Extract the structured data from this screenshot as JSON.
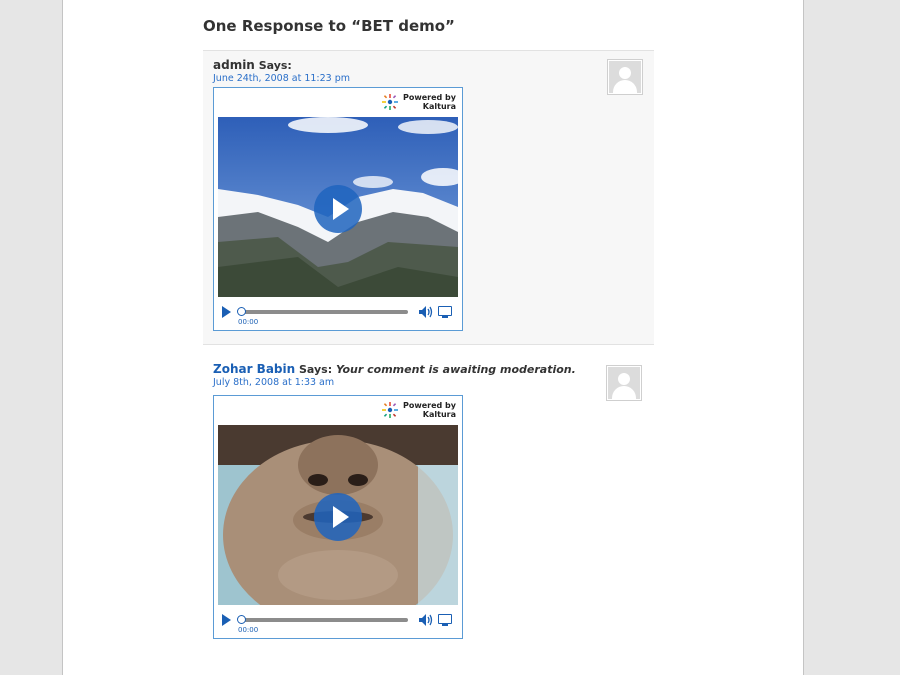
{
  "heading": "One Response to “BET demo”",
  "comments": [
    {
      "author": "admin",
      "says": "Says:",
      "moderation": "",
      "date": "June 24th, 2008 at 11:23 pm",
      "player": {
        "powered_line1": "Powered by",
        "powered_line2": "Kaltura",
        "time": "00:00",
        "progress": 0
      }
    },
    {
      "author": "Zohar Babin",
      "says": "Says:",
      "moderation": "Your comment is awaiting moderation.",
      "date": "July 8th, 2008 at 1:33 am",
      "player": {
        "powered_line1": "Powered by",
        "powered_line2": "Kaltura",
        "time": "00:00",
        "progress": 0
      }
    }
  ],
  "colors": {
    "link": "#1a5fb4",
    "accent": "#5b9bd5",
    "comment_bg": "#f7f7f7"
  },
  "icons": [
    "kaltura-logo-icon",
    "play-overlay-icon",
    "play-icon",
    "volume-icon",
    "fullscreen-icon",
    "avatar-icon"
  ]
}
